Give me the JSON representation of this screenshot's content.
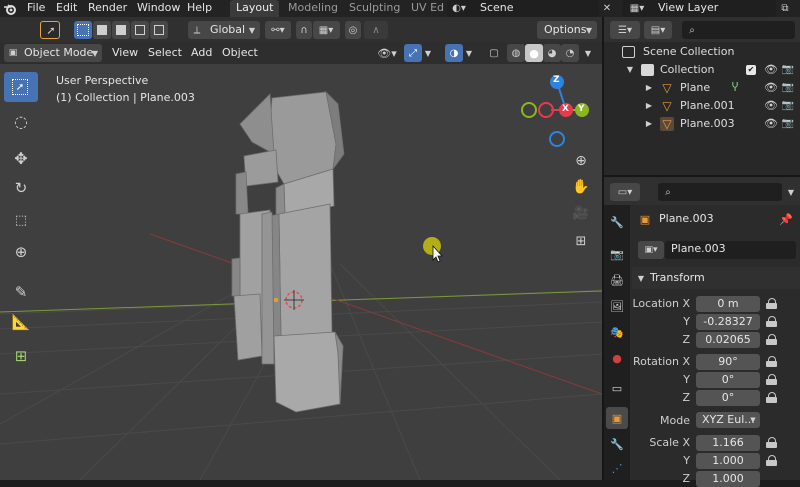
{
  "topbar": {
    "menus": [
      "File",
      "Edit",
      "Render",
      "Window",
      "Help"
    ],
    "workspaces": [
      "Layout",
      "Modeling",
      "Sculpting",
      "UV Ed"
    ],
    "active_workspace": "Layout",
    "scene": "Scene",
    "view_layer": "View Layer"
  },
  "toolbar": {
    "transform_orientation": "Global",
    "options_label": "Options"
  },
  "viewport_header": {
    "mode": "Object Mode",
    "menus": [
      "View",
      "Select",
      "Add",
      "Object"
    ]
  },
  "viewport": {
    "view_name": "User Perspective",
    "collection_info": "(1) Collection | Plane.003",
    "gizmo": {
      "z": "Z",
      "x": "X",
      "y": "Y"
    }
  },
  "outliner": {
    "root": "Scene Collection",
    "collection": "Collection",
    "objects": [
      "Plane",
      "Plane.001",
      "Plane.003"
    ]
  },
  "properties": {
    "object_name": "Plane.003",
    "datablock_name": "Plane.003",
    "panel_title": "Transform",
    "location": {
      "label": "Location X",
      "x": "0 m",
      "y": "-0.28327",
      "z": "0.02065"
    },
    "rotation": {
      "label": "Rotation X",
      "x": "90°",
      "y": "0°",
      "z": "0°"
    },
    "mode": {
      "label": "Mode",
      "value": "XYZ Eul..."
    },
    "scale": {
      "label": "Scale X",
      "x": "1.166",
      "y": "1.000",
      "z": "1.000"
    },
    "axis_y": "Y",
    "axis_z": "Z"
  },
  "colors": {
    "accent": "#4772b3",
    "axis_x": "#e8394e",
    "axis_y": "#8ab71f",
    "axis_z": "#2f83e0",
    "object_orange": "#e89a37"
  }
}
